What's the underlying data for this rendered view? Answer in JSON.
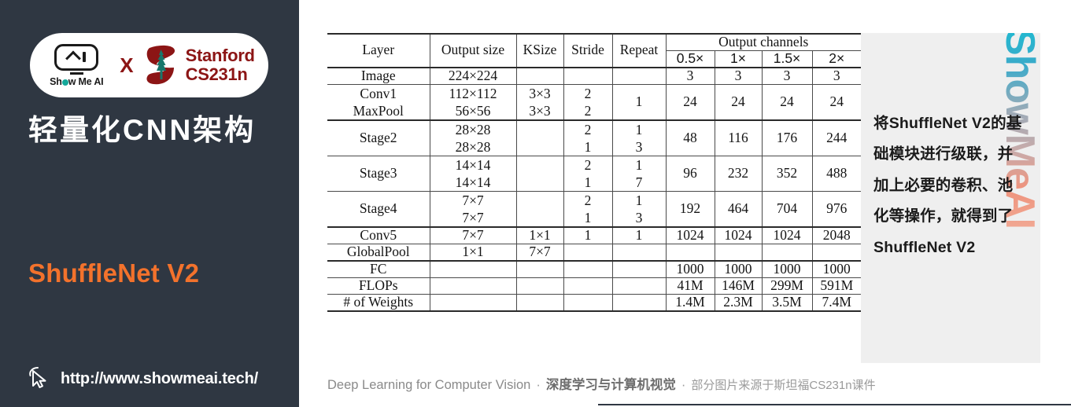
{
  "sidebar": {
    "brand": {
      "showmeai_label": "Show Me AI",
      "x_label": "X",
      "stanford_line1": "Stanford",
      "stanford_line2": "CS231n"
    },
    "section_title": "轻量化CNN架构",
    "topic_title": "ShuffleNet V2",
    "site_url": "http://www.showmeai.tech/",
    "colors": {
      "panel_bg": "#2F3742",
      "accent_orange": "#F3722C",
      "stanford_red": "#8C1515",
      "title_white": "#FFFFFF"
    }
  },
  "note_panel": {
    "watermark": "ShowMeAI",
    "text": "将ShuffleNet V2的基础模块进行级联，并加上必要的卷积、池化等操作，就得到了ShuffleNet V2",
    "bg_color": "#EFEFEF"
  },
  "footer": {
    "english": "Deep Learning for Computer Vision",
    "sep1": "·",
    "chinese": "深度学习与计算机视觉",
    "sep2": "·",
    "source": "部分图片来源于斯坦福CS231n课件"
  },
  "table": {
    "group_header": "Output channels",
    "headers": [
      "Layer",
      "Output size",
      "KSize",
      "Stride",
      "Repeat"
    ],
    "channel_headers": [
      "0.5×",
      "1×",
      "1.5×",
      "2×"
    ],
    "rows": [
      {
        "layer": "Image",
        "output_size": [
          "224×224"
        ],
        "ksize": [
          ""
        ],
        "stride": [
          ""
        ],
        "repeat": [
          ""
        ],
        "channels": [
          "3",
          "3",
          "3",
          "3"
        ]
      },
      {
        "layer": [
          "Conv1",
          "MaxPool"
        ],
        "output_size": [
          "112×112",
          "56×56"
        ],
        "ksize": [
          "3×3",
          "3×3"
        ],
        "stride": [
          "2",
          "2"
        ],
        "repeat": [
          "1"
        ],
        "channels": [
          "24",
          "24",
          "24",
          "24"
        ]
      },
      {
        "layer": "Stage2",
        "output_size": [
          "28×28",
          "28×28"
        ],
        "ksize": [
          ""
        ],
        "stride": [
          "2",
          "1"
        ],
        "repeat": [
          "1",
          "3"
        ],
        "channels": [
          "48",
          "116",
          "176",
          "244"
        ]
      },
      {
        "layer": "Stage3",
        "output_size": [
          "14×14",
          "14×14"
        ],
        "ksize": [
          ""
        ],
        "stride": [
          "2",
          "1"
        ],
        "repeat": [
          "1",
          "7"
        ],
        "channels": [
          "96",
          "232",
          "352",
          "488"
        ]
      },
      {
        "layer": "Stage4",
        "output_size": [
          "7×7",
          "7×7"
        ],
        "ksize": [
          ""
        ],
        "stride": [
          "2",
          "1"
        ],
        "repeat": [
          "1",
          "3"
        ],
        "channels": [
          "192",
          "464",
          "704",
          "976"
        ]
      },
      {
        "layer": "Conv5",
        "output_size": [
          "7×7"
        ],
        "ksize": [
          "1×1"
        ],
        "stride": [
          "1"
        ],
        "repeat": [
          "1"
        ],
        "channels": [
          "1024",
          "1024",
          "1024",
          "2048"
        ]
      },
      {
        "layer": "GlobalPool",
        "output_size": [
          "1×1"
        ],
        "ksize": [
          "7×7"
        ],
        "stride": [
          ""
        ],
        "repeat": [
          ""
        ],
        "channels": [
          "",
          "",
          "",
          ""
        ]
      },
      {
        "layer": "FC",
        "output_size": [
          ""
        ],
        "ksize": [
          ""
        ],
        "stride": [
          ""
        ],
        "repeat": [
          ""
        ],
        "channels": [
          "1000",
          "1000",
          "1000",
          "1000"
        ]
      },
      {
        "layer": "FLOPs",
        "output_size": [
          ""
        ],
        "ksize": [
          ""
        ],
        "stride": [
          ""
        ],
        "repeat": [
          ""
        ],
        "channels": [
          "41M",
          "146M",
          "299M",
          "591M"
        ]
      },
      {
        "layer": "# of Weights",
        "output_size": [
          ""
        ],
        "ksize": [
          ""
        ],
        "stride": [
          ""
        ],
        "repeat": [
          ""
        ],
        "channels": [
          "1.4M",
          "2.3M",
          "3.5M",
          "7.4M"
        ]
      }
    ]
  }
}
